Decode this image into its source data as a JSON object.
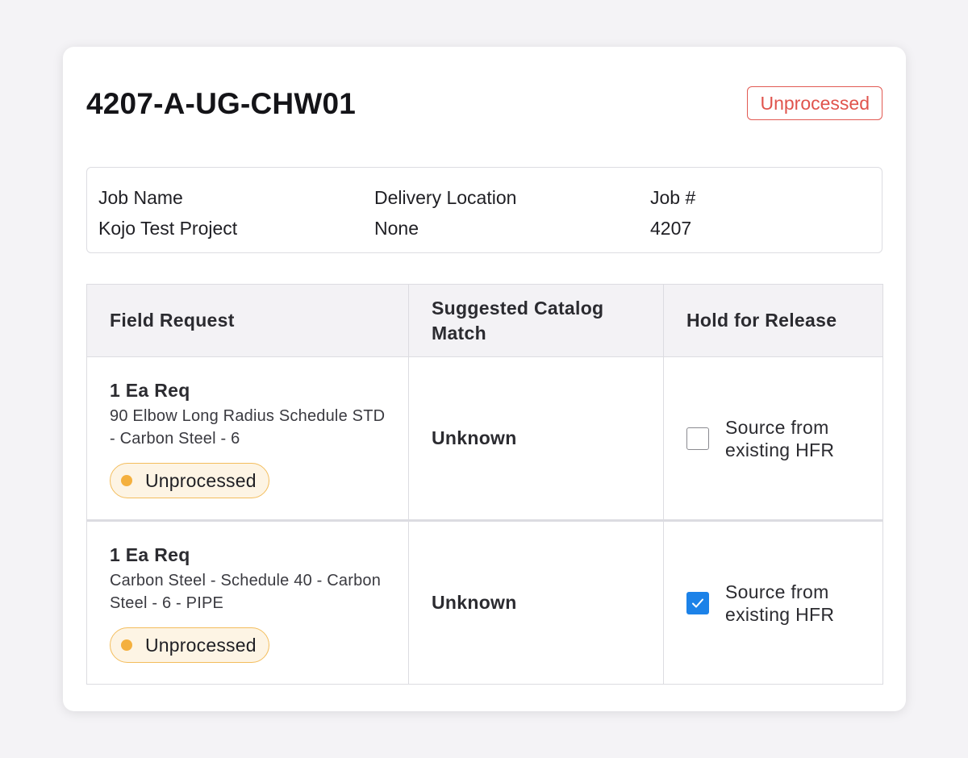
{
  "header": {
    "title": "4207-A-UG-CHW01",
    "status": "Unprocessed"
  },
  "info": {
    "job_name_label": "Job Name",
    "job_name_value": "Kojo Test Project",
    "delivery_label": "Delivery Location",
    "delivery_value": "None",
    "job_number_label": "Job #",
    "job_number_value": "4207"
  },
  "table": {
    "columns": [
      "Field Request",
      "Suggested Catalog Match",
      "Hold for Release"
    ],
    "rows": [
      {
        "quantity": "1 Ea Req",
        "description": "90 Elbow Long Radius Schedule STD - Carbon Steel - 6",
        "status": "Unprocessed",
        "match": "Unknown",
        "hold_label": "Source from existing HFR",
        "hold_checked": false
      },
      {
        "quantity": "1 Ea Req",
        "description": "Carbon Steel - Schedule 40 - Carbon Steel - 6 - PIPE",
        "status": "Unprocessed",
        "match": "Unknown",
        "hold_label": "Source from existing HFR",
        "hold_checked": true
      }
    ]
  },
  "colors": {
    "status_tag": "#e0544d",
    "pill_border": "#f3bd5c",
    "pill_dot": "#f4b03e",
    "checkbox_checked": "#1c82e8"
  }
}
